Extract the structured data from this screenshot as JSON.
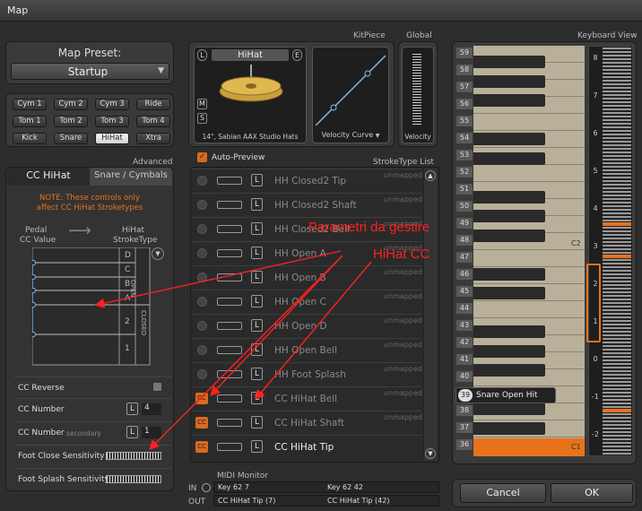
{
  "window": {
    "title": "Map"
  },
  "preset": {
    "label": "Map Preset:",
    "value": "Startup"
  },
  "kit_pieces": [
    "Cym 1",
    "Cym 2",
    "Cym 3",
    "Ride",
    "Tom 1",
    "Tom 2",
    "Tom 3",
    "Tom 4",
    "Kick",
    "Snare",
    "HiHat",
    "Xtra"
  ],
  "selected_piece": "HiHat",
  "advanced_label": "Advanced",
  "tabs": {
    "cc": "CC HiHat",
    "snare": "Snare / Cymbals"
  },
  "note": {
    "line1": "NOTE: These controls only",
    "line2": "affect CC HiHat Stroketypes"
  },
  "pedal": {
    "left1": "Pedal",
    "left2": "CC Value",
    "right1": "HiHat",
    "right2": "StrokeType",
    "zones": [
      "D",
      "C",
      "B",
      "A",
      "2",
      "1"
    ],
    "open": "OPEN",
    "closed": "CLOSED"
  },
  "controls": {
    "reverse": "CC Reverse",
    "number": "CC Number",
    "number_val": "4",
    "secondary": "CC Number",
    "secondary_tag": "secondary",
    "secondary_val": "1",
    "foot_close": "Foot Close Sensitivity",
    "foot_splash": "Foot Splash Sensitivity"
  },
  "kitpiece": {
    "header": "KitPiece",
    "global": "Global",
    "name": "HiHat",
    "model": "14\", Sabian AAX Studio Hats",
    "curve": "Velocity Curve",
    "velocity": "Velocity",
    "side_l": "L",
    "side_e": "E",
    "side_m": "M",
    "side_s": "S"
  },
  "auto_preview": "Auto-Preview",
  "stroke_list": {
    "title": "StrokeType List",
    "unmapped": "unmapped",
    "lock": "L",
    "cc_tag": "CC",
    "items": [
      {
        "name": "HH Closed2 Tip",
        "cc": false,
        "active": false
      },
      {
        "name": "HH Closed2 Shaft",
        "cc": false,
        "active": false
      },
      {
        "name": "HH Closed2 Bell",
        "cc": false,
        "active": false
      },
      {
        "name": "HH Open A",
        "cc": false,
        "active": false
      },
      {
        "name": "HH Open B",
        "cc": false,
        "active": false
      },
      {
        "name": "HH Open C",
        "cc": false,
        "active": false
      },
      {
        "name": "HH Open D",
        "cc": false,
        "active": false
      },
      {
        "name": "HH Open Bell",
        "cc": false,
        "active": false
      },
      {
        "name": "HH Foot Splash",
        "cc": false,
        "active": false
      },
      {
        "name": "CC HiHat Bell",
        "cc": true,
        "active": false
      },
      {
        "name": "CC HiHat Shaft",
        "cc": true,
        "active": false
      },
      {
        "name": "CC HiHat Tip",
        "cc": true,
        "active": true
      }
    ]
  },
  "midi": {
    "title": "MIDI Monitor",
    "in_label": "IN",
    "out_label": "OUT",
    "in1": "Key 62 7",
    "in2": "Key 62 42",
    "out1": "CC HiHat Tip (7)",
    "out2": "CC HiHat Tip (42)"
  },
  "keyboard": {
    "title": "Keyboard View",
    "keys": [
      "59",
      "58",
      "57",
      "56",
      "55",
      "54",
      "53",
      "52",
      "51",
      "50",
      "49",
      "48",
      "47",
      "46",
      "45",
      "44",
      "43",
      "42",
      "41",
      "40",
      "39",
      "38",
      "37",
      "36"
    ],
    "c2": "C2",
    "c1": "C1",
    "highlight_key": "39",
    "highlight_label": "Snare Open Hit",
    "octaves": [
      "8",
      "7",
      "6",
      "5",
      "4",
      "3",
      "2",
      "1",
      "0",
      "-1",
      "-2"
    ]
  },
  "buttons": {
    "cancel": "Cancel",
    "ok": "OK"
  },
  "annotation": {
    "line1": "Parametri da gestire",
    "line2": "HiHat CC"
  },
  "colors": {
    "accent": "#e8721c",
    "annotation": "#ff2020"
  }
}
